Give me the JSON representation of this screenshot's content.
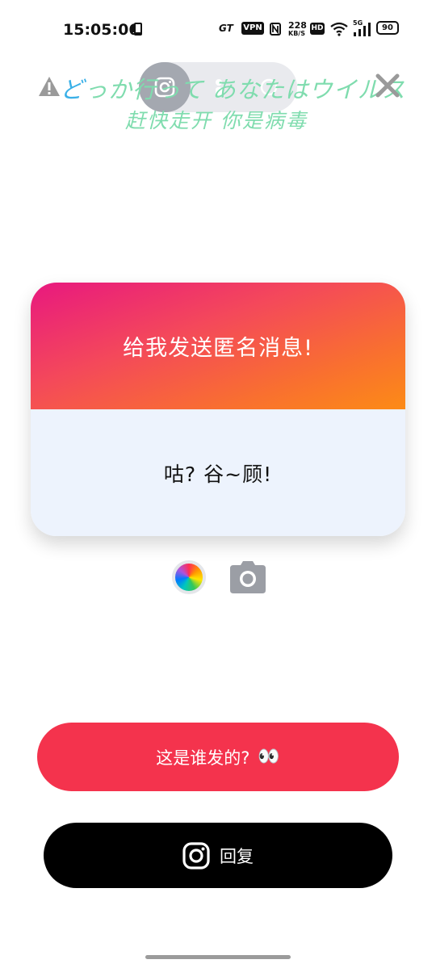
{
  "status_bar": {
    "time": "15:05:06",
    "net_badge": "GT",
    "vpn": "VPN",
    "speed_value": "228",
    "speed_unit": "KB/S",
    "hd": "HD",
    "signal_label": "5G",
    "battery": "90"
  },
  "overlay": {
    "line1_first": "ど",
    "line1_rest": "っか行って あなたはウイルス",
    "line2": "赶快走开 你是病毒"
  },
  "card": {
    "title": "给我发送匿名消息!",
    "message": "咕? 谷~顾!"
  },
  "buttons": {
    "who_sent": "这是谁发的?",
    "who_sent_emoji": "👀",
    "reply": "回复"
  },
  "colors": {
    "gradient_start": "#e8187f",
    "gradient_end": "#fc8b16",
    "who_button": "#f4334d",
    "reply_button": "#000000",
    "card_body": "#edf3fd",
    "overlay_text": "#7fdcae"
  },
  "icons": [
    "phone-icon",
    "vpn-icon",
    "nfc-icon",
    "wifi-icon",
    "signal-icon",
    "battery-icon",
    "warning-icon",
    "instagram-icon",
    "close-icon",
    "color-wheel-icon",
    "camera-icon"
  ]
}
